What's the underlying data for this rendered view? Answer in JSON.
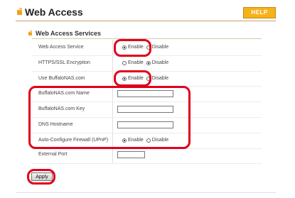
{
  "page": {
    "title": "Web Access",
    "help_label": "HELP"
  },
  "section": {
    "title": "Web Access Services"
  },
  "rows": [
    {
      "label": "Web Access Service",
      "type": "radio",
      "options": [
        "Enable",
        "Disable"
      ],
      "selected": "Enable"
    },
    {
      "label": "HTTPS/SSL Encryption",
      "type": "radio",
      "options": [
        "Enable",
        "Disable"
      ],
      "selected": "Disable"
    },
    {
      "label": "Use BuffaloNAS.com",
      "type": "radio",
      "options": [
        "Enable",
        "Disable"
      ],
      "selected": "Enable"
    },
    {
      "label": "BuffaloNAS.com Name",
      "type": "text",
      "value": ""
    },
    {
      "label": "BuffaloNAS.com Key",
      "type": "text",
      "value": ""
    },
    {
      "label": "DNS Hostname",
      "type": "text",
      "value": ""
    },
    {
      "label": "Auto-Configure Firewall (UPnP)",
      "type": "radio",
      "options": [
        "Enable",
        "Disable"
      ],
      "selected": "Enable"
    },
    {
      "label": "External Port",
      "type": "text",
      "value": ""
    }
  ],
  "actions": {
    "apply_label": "Apply"
  },
  "colors": {
    "highlight": "#e0001a",
    "help_button": "#f6b21a",
    "accent_icon": "#f0a020"
  }
}
